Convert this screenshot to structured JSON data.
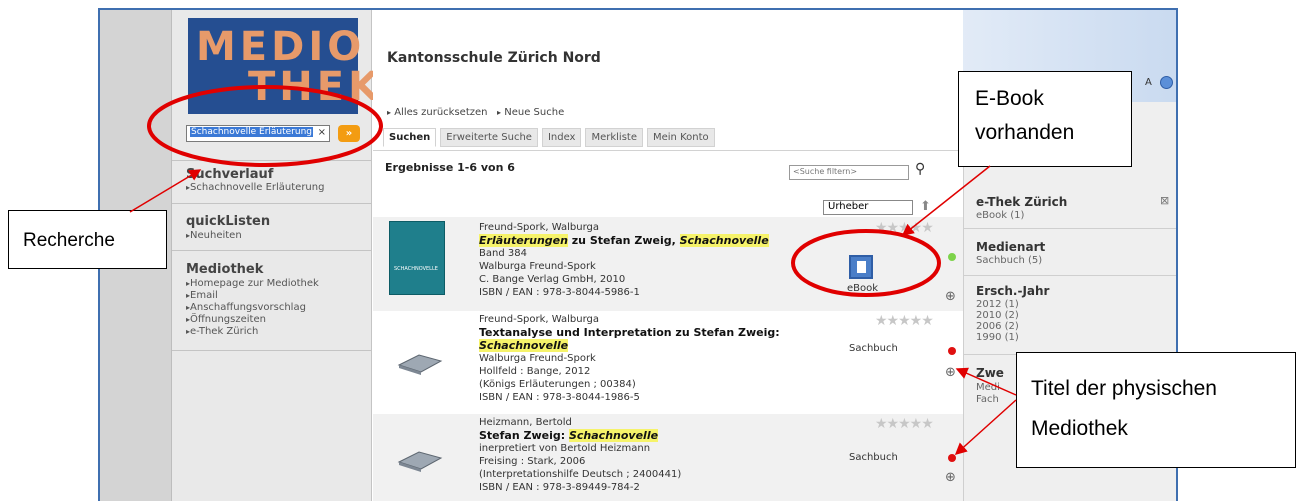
{
  "logo": {
    "line1": "MEDIO",
    "line2": "THEK"
  },
  "search": {
    "value": "Schachnovelle Erläuterung",
    "clear": "×",
    "go": "»"
  },
  "sidebar": {
    "suchverlauf": {
      "heading": "Suchverlauf",
      "items": [
        "Schachnovelle Erläuterung"
      ]
    },
    "quicklisten": {
      "heading": "quickListen",
      "items": [
        "Neuheiten"
      ]
    },
    "mediothek": {
      "heading": "Mediothek",
      "items": [
        "Homepage zur Mediothek",
        "Email",
        "Anschaffungsvorschlag",
        "Öffnungszeiten",
        "e-Thek Zürich"
      ]
    }
  },
  "header": {
    "school": "Kantonsschule Zürich Nord",
    "links": [
      "Alles zurücksetzen",
      "Neue Suche"
    ],
    "font_toggle": "A"
  },
  "tabs": [
    "Suchen",
    "Erweiterte Suche",
    "Index",
    "Merkliste",
    "Mein Konto"
  ],
  "results": {
    "title": "Ergebnisse 1-6 von 6",
    "filter_placeholder": "<Suche filtern>",
    "sort_value": "Urheber",
    "items": [
      {
        "author": "Freund-Spork, Walburga",
        "title_a": "Erläuterungen",
        "title_b": " zu Stefan Zweig, ",
        "title_c": "Schachnovelle",
        "l1": "Band 384",
        "l2": "Walburga Freund-Spork",
        "l3": "C. Bange Verlag GmbH, 2010",
        "l4": "ISBN / EAN : 978-3-8044-5986-1",
        "type": "eBook",
        "cover_text": "SCHACHNOVELLE"
      },
      {
        "author": "Freund-Spork, Walburga",
        "title_a": "Textanalyse und Interpretation zu Stefan Zweig:",
        "title_c": "Schachnovelle",
        "l1": "Walburga Freund-Spork",
        "l2": "Hollfeld : Bange, 2012",
        "l3": "(Königs Erläuterungen ; 00384)",
        "l4": "ISBN / EAN : 978-3-8044-1986-5",
        "type": "Sachbuch"
      },
      {
        "author": "Heizmann, Bertold",
        "title_a": "Stefan Zweig: ",
        "title_c": "Schachnovelle",
        "l1": "inerpretiert von Bertold Heizmann",
        "l2": "Freising : Stark, 2006",
        "l3": "(Interpretationshilfe Deutsch ; 2400441)",
        "l4": "ISBN / EAN : 978-3-89449-784-2",
        "type": "Sachbuch"
      }
    ]
  },
  "facets": {
    "ethek": {
      "heading": "e-Thek Zürich",
      "items": [
        "eBook (1)"
      ],
      "close": "⊠"
    },
    "medienart": {
      "heading": "Medienart",
      "items": [
        "Sachbuch (5)"
      ]
    },
    "jahr": {
      "heading": "Ersch.-Jahr",
      "items": [
        "2012 (1)",
        "2010 (2)",
        "2006 (2)",
        "1990 (1)"
      ]
    },
    "zwe": {
      "heading": "Zwe",
      "items": [
        "Medi",
        "Fach"
      ]
    }
  },
  "callouts": {
    "recherche": "Recherche",
    "ebook_line1": "E-Book",
    "ebook_line2": "vorhanden",
    "titel_line1": "Titel der physischen",
    "titel_line2": "Mediothek"
  },
  "colors": {
    "annotation_red": "#e00000",
    "logo_bg": "#254e91",
    "highlight": "#f6f36a",
    "available_green": "#7dd34a",
    "unavailable_red": "#e01010"
  }
}
